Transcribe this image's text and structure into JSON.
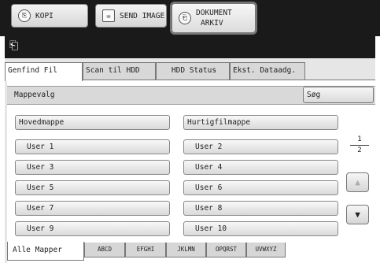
{
  "mode_buttons": [
    {
      "label": "KOPI",
      "icon": "copy-icon"
    },
    {
      "label": "SEND IMAGE",
      "icon": "send-image-icon"
    },
    {
      "label_line1": "DOKUMENT",
      "label_line2": "ARKIV",
      "icon": "document-filing-icon"
    }
  ],
  "tabs": [
    "Genfind Fil",
    "Scan til HDD",
    "HDD Status",
    "Ekst. Dataadg."
  ],
  "folder_select": {
    "label": "Mappevalg",
    "search_label": "Søg"
  },
  "folders": {
    "main": "Hovedmappe",
    "quick": "Hurtigfilmappe",
    "users": [
      "User 1",
      "User 2",
      "User 3",
      "User 4",
      "User 5",
      "User 6",
      "User 7",
      "User 8",
      "User 9",
      "User 10"
    ]
  },
  "pagination": {
    "current": "1",
    "total": "2"
  },
  "index_tabs": [
    "Alle Mapper",
    "ABCD",
    "EFGHI",
    "JKLMN",
    "OPQRST",
    "UVWXYZ"
  ]
}
